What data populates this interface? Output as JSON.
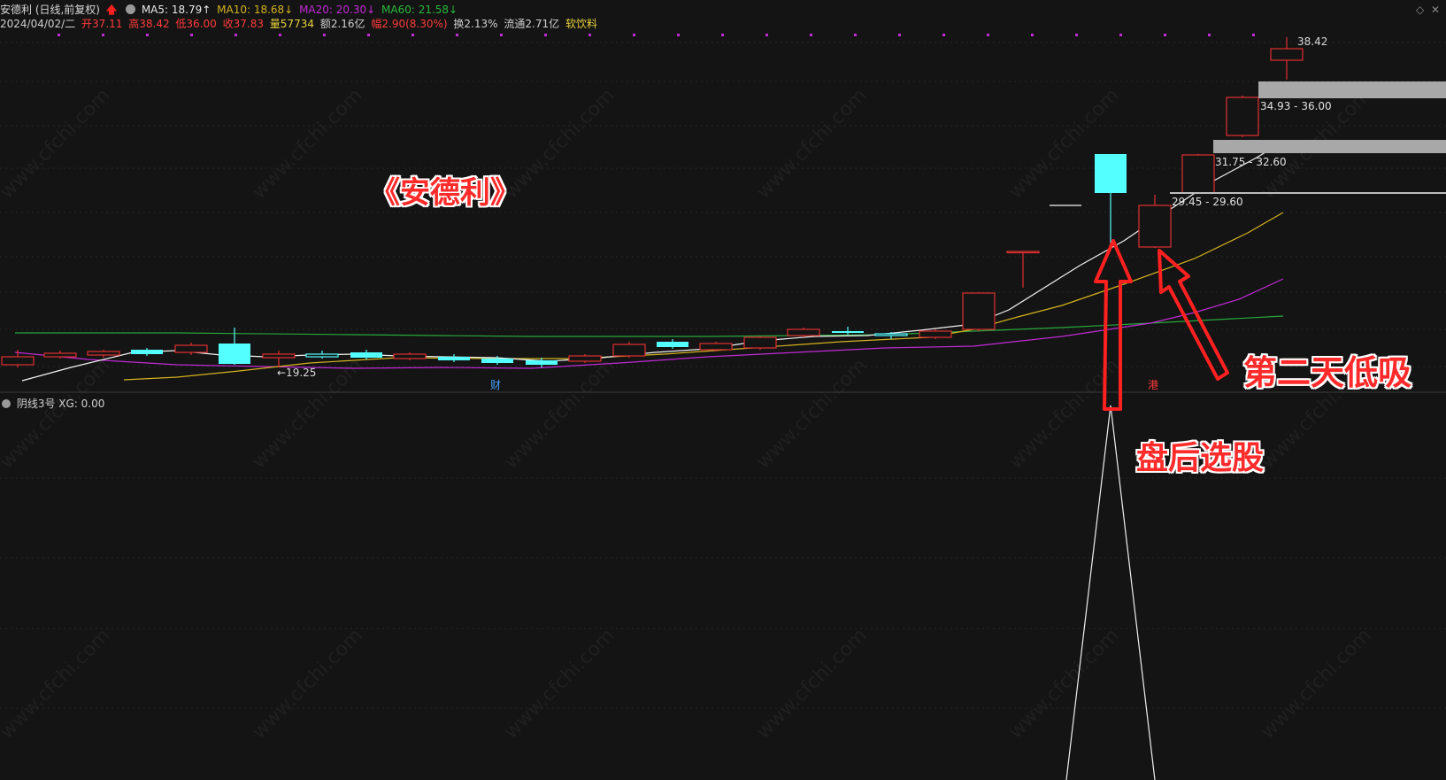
{
  "header": {
    "title": "安德利 (日线,前复权)",
    "ma5": "MA5: 18.79↑",
    "ma10": "MA10: 18.68↓",
    "ma20": "MA20: 20.30↓",
    "ma60": "MA60: 21.58↓",
    "date": "2024/04/02/二",
    "open": "开37.11",
    "high": "高38.42",
    "low": "低36.00",
    "close": "收37.83",
    "volume": "量57734",
    "amount": "额2.16亿",
    "change": "幅2.90(8.30%)",
    "turnover": "换2.13%",
    "float_cap": "流通2.71亿",
    "sector": "软饮料"
  },
  "indicator": {
    "label": "阴线3号 XG: 0.00"
  },
  "annotations": {
    "stock_title": "《安德利》",
    "second_day": "第二天低吸",
    "post_market": "盘后选股",
    "low_price": "←19.25",
    "high_price": "38.42",
    "zone1": "34.93 - 36.00",
    "zone2": "31.75 - 32.60",
    "zone3": "29.45 - 29.60",
    "marker_cai": "财",
    "marker_gang": "港"
  },
  "watermark": "www.cfchi.com",
  "colors": {
    "background": "#141414",
    "up": "#e03030",
    "down": "#54ffff",
    "ma5": "#ffffff",
    "ma10": "#d4b21e",
    "ma20": "#c22ad6",
    "ma60": "#28a83c",
    "annotation": "#ff2a2a"
  }
}
